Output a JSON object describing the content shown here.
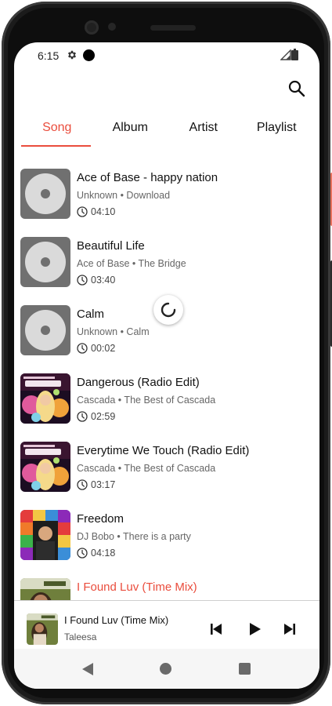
{
  "status_bar": {
    "time": "6:15"
  },
  "tabs": [
    "Song",
    "Album",
    "Artist",
    "Playlist"
  ],
  "active_tab": "Song",
  "songs": [
    {
      "title": "Ace of Base - happy nation",
      "subtitle": "Unknown • Download",
      "duration": "04:10",
      "art": "default"
    },
    {
      "title": "Beautiful Life",
      "subtitle": "Ace of Base • The Bridge",
      "duration": "03:40",
      "art": "default"
    },
    {
      "title": "Calm",
      "subtitle": "Unknown • Calm",
      "duration": "00:02",
      "art": "default"
    },
    {
      "title": "Dangerous (Radio Edit)",
      "subtitle": "Cascada • The Best of Cascada",
      "duration": "02:59",
      "art": "cascada-cover"
    },
    {
      "title": "Everytime We Touch (Radio Edit)",
      "subtitle": "Cascada • The Best of Cascada",
      "duration": "03:17",
      "art": "cascada-cover"
    },
    {
      "title": "Freedom",
      "subtitle": "DJ Bobo • There is a party",
      "duration": "04:18",
      "art": "djbobo-cover"
    },
    {
      "title": "I Found Luv (Time Mix)",
      "subtitle": "",
      "duration": "",
      "art": "taleesa-cover",
      "playing": true
    }
  ],
  "now_playing": {
    "title": "I Found Luv (Time Mix)",
    "artist": "Taleesa"
  },
  "colors": {
    "accent": "#ea4d3d",
    "art_default": "#707070",
    "disc": "#dadada"
  },
  "icons": [
    "gear-icon",
    "signal-icon",
    "battery-icon",
    "search-icon",
    "clock-icon",
    "loading-spinner",
    "skip-previous-icon",
    "play-icon",
    "skip-next-icon",
    "nav-back-icon",
    "nav-home-icon",
    "nav-recents-icon"
  ]
}
